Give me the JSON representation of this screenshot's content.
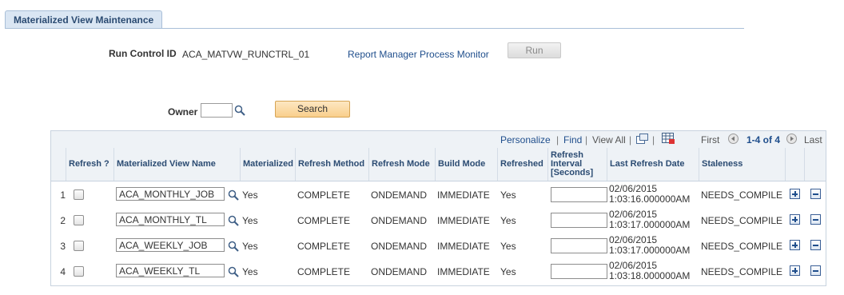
{
  "tab": {
    "label": "Materialized View Maintenance"
  },
  "run_control": {
    "label": "Run Control ID",
    "value": "ACA_MATVW_RUNCTRL_01",
    "links": "Report Manager Process Monitor",
    "run_label": "Run"
  },
  "owner": {
    "label": "Owner",
    "value": "",
    "search_label": "Search"
  },
  "grid": {
    "toolbar": {
      "personalize": "Personalize",
      "find": "Find",
      "view_all": "View All",
      "first": "First",
      "range": "1-4 of 4",
      "last": "Last"
    },
    "columns": [
      "Refresh ?",
      "Materialized View Name",
      "Materialized",
      "Refresh Method",
      "Refresh Mode",
      "Build Mode",
      "Refreshed",
      "Refresh Interval [Seconds]",
      "Last Refresh Date",
      "Staleness"
    ],
    "rows": [
      {
        "num": "1",
        "name": "ACA_MONTHLY_JOB",
        "materialized": "Yes",
        "method": "COMPLETE",
        "mode": "ONDEMAND",
        "build": "IMMEDIATE",
        "refreshed": "Yes",
        "interval": "",
        "date_line1": "02/06/2015",
        "date_line2": "1:03:16.000000AM",
        "staleness": "NEEDS_COMPILE"
      },
      {
        "num": "2",
        "name": "ACA_MONTHLY_TL",
        "materialized": "Yes",
        "method": "COMPLETE",
        "mode": "ONDEMAND",
        "build": "IMMEDIATE",
        "refreshed": "Yes",
        "interval": "",
        "date_line1": "02/06/2015",
        "date_line2": "1:03:17.000000AM",
        "staleness": "NEEDS_COMPILE"
      },
      {
        "num": "3",
        "name": "ACA_WEEKLY_JOB",
        "materialized": "Yes",
        "method": "COMPLETE",
        "mode": "ONDEMAND",
        "build": "IMMEDIATE",
        "refreshed": "Yes",
        "interval": "",
        "date_line1": "02/06/2015",
        "date_line2": "1:03:17.000000AM",
        "staleness": "NEEDS_COMPILE"
      },
      {
        "num": "4",
        "name": "ACA_WEEKLY_TL",
        "materialized": "Yes",
        "method": "COMPLETE",
        "mode": "ONDEMAND",
        "build": "IMMEDIATE",
        "refreshed": "Yes",
        "interval": "",
        "date_line1": "02/06/2015",
        "date_line2": "1:03:18.000000AM",
        "staleness": "NEEDS_COMPILE"
      }
    ]
  }
}
